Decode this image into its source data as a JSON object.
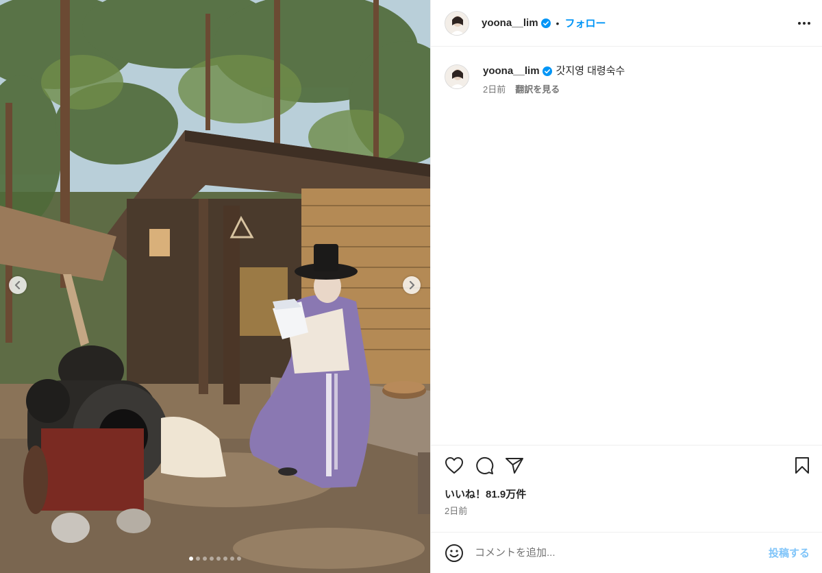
{
  "post": {
    "author": {
      "username": "yoona__lim",
      "verified": true,
      "avatar_icon": "profile-photo-avatar"
    },
    "header": {
      "separator": "•",
      "follow_label": "フォロー",
      "more_icon": "more-horizontal-icon"
    },
    "media": {
      "slide_count": 8,
      "active_slide": 1,
      "prev_icon": "chevron-left-icon",
      "next_icon": "chevron-right-icon"
    },
    "caption": {
      "username": "yoona__lim",
      "text": "갓지영 대령숙수",
      "time": "2日前",
      "translate_label": "翻訳を見る"
    },
    "actions": {
      "like_icon": "heart-icon",
      "comment_icon": "comment-icon",
      "share_icon": "share-icon",
      "save_icon": "bookmark-icon"
    },
    "likes_text": "いいね！81.9万件",
    "date_text": "2日前",
    "comment_box": {
      "placeholder": "コメントを追加...",
      "post_label": "投稿する",
      "emoji_icon": "emoji-icon"
    },
    "colors": {
      "accent": "#0095f6",
      "post_button_disabled": "#7fc4f9",
      "text_primary": "#262626",
      "text_secondary": "#737373",
      "border": "#efefef"
    }
  }
}
